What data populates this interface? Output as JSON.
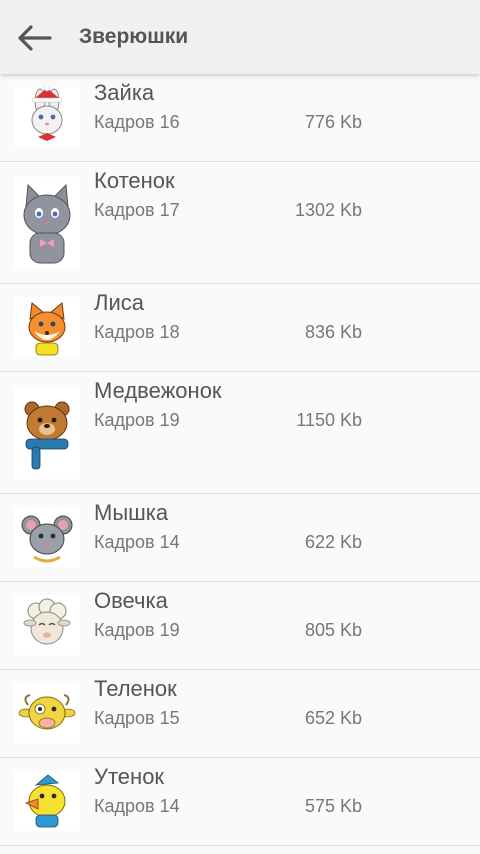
{
  "header": {
    "title": "Зверюшки",
    "back_icon": "arrow-left-icon"
  },
  "colors": {
    "appbar": "#f0f0f0",
    "background": "#fafafa",
    "text_primary": "#555555",
    "text_secondary": "#777777"
  },
  "items": [
    {
      "name": "Зайка",
      "frames": "Кадров 16",
      "size": "776 Kb",
      "icon": "bunny-sticker"
    },
    {
      "name": "Котенок",
      "frames": "Кадров 17",
      "size": "1302 Kb",
      "icon": "kitten-sticker"
    },
    {
      "name": "Лиса",
      "frames": "Кадров 18",
      "size": "836 Kb",
      "icon": "fox-sticker"
    },
    {
      "name": "Медвежонок",
      "frames": "Кадров 19",
      "size": "1150 Kb",
      "icon": "bear-cub-sticker"
    },
    {
      "name": "Мышка",
      "frames": "Кадров 14",
      "size": "622 Kb",
      "icon": "mouse-sticker"
    },
    {
      "name": "Овечка",
      "frames": "Кадров 19",
      "size": "805 Kb",
      "icon": "sheep-sticker"
    },
    {
      "name": "Теленок",
      "frames": "Кадров 15",
      "size": "652 Kb",
      "icon": "calf-sticker"
    },
    {
      "name": "Утенок",
      "frames": "Кадров 14",
      "size": "575 Kb",
      "icon": "duckling-sticker"
    }
  ]
}
